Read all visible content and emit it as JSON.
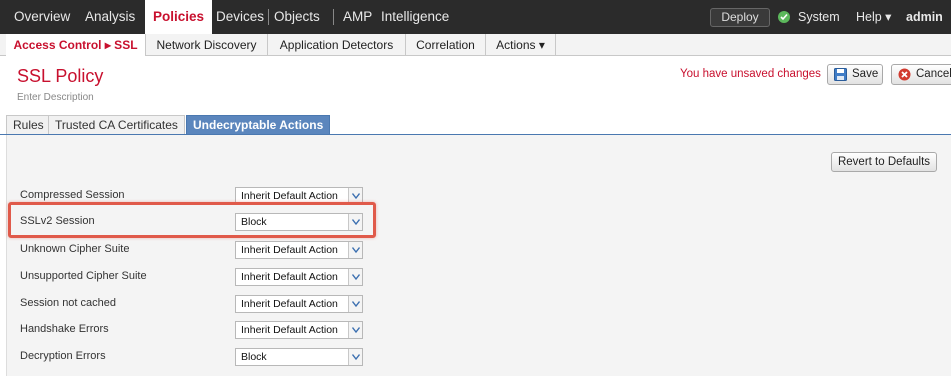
{
  "topnav": {
    "items": [
      "Overview",
      "Analysis",
      "Policies",
      "Devices",
      "Objects",
      "AMP",
      "Intelligence"
    ],
    "active": "Policies",
    "deploy_label": "Deploy",
    "system_label": "System",
    "help_label": "Help ▾",
    "user_label": "admin ▾",
    "status_color": "#5cb85c"
  },
  "subnav": {
    "items": [
      "Access Control ▸ SSL",
      "Network Discovery",
      "Application Detectors",
      "Correlation",
      "Actions ▾"
    ]
  },
  "header": {
    "title": "SSL Policy",
    "description": "Enter Description",
    "unsaved_text": "You have unsaved changes",
    "save_label": "Save",
    "cancel_label": "Cancel"
  },
  "tabs": [
    "Rules",
    "Trusted CA Certificates",
    "Undecryptable Actions"
  ],
  "active_tab": "Undecryptable Actions",
  "revert_label": "Revert to Defaults",
  "rows": [
    {
      "label": "Compressed Session",
      "value": "Inherit Default Action"
    },
    {
      "label": "SSLv2 Session",
      "value": "Block"
    },
    {
      "label": "Unknown Cipher Suite",
      "value": "Inherit Default Action"
    },
    {
      "label": "Unsupported Cipher Suite",
      "value": "Inherit Default Action"
    },
    {
      "label": "Session not cached",
      "value": "Inherit Default Action"
    },
    {
      "label": "Handshake Errors",
      "value": "Inherit Default Action"
    },
    {
      "label": "Decryption Errors",
      "value": "Block"
    }
  ],
  "colors": {
    "brand_red": "#c8102e",
    "tab_blue": "#5b86bd",
    "highlight": "#e05a4a"
  }
}
